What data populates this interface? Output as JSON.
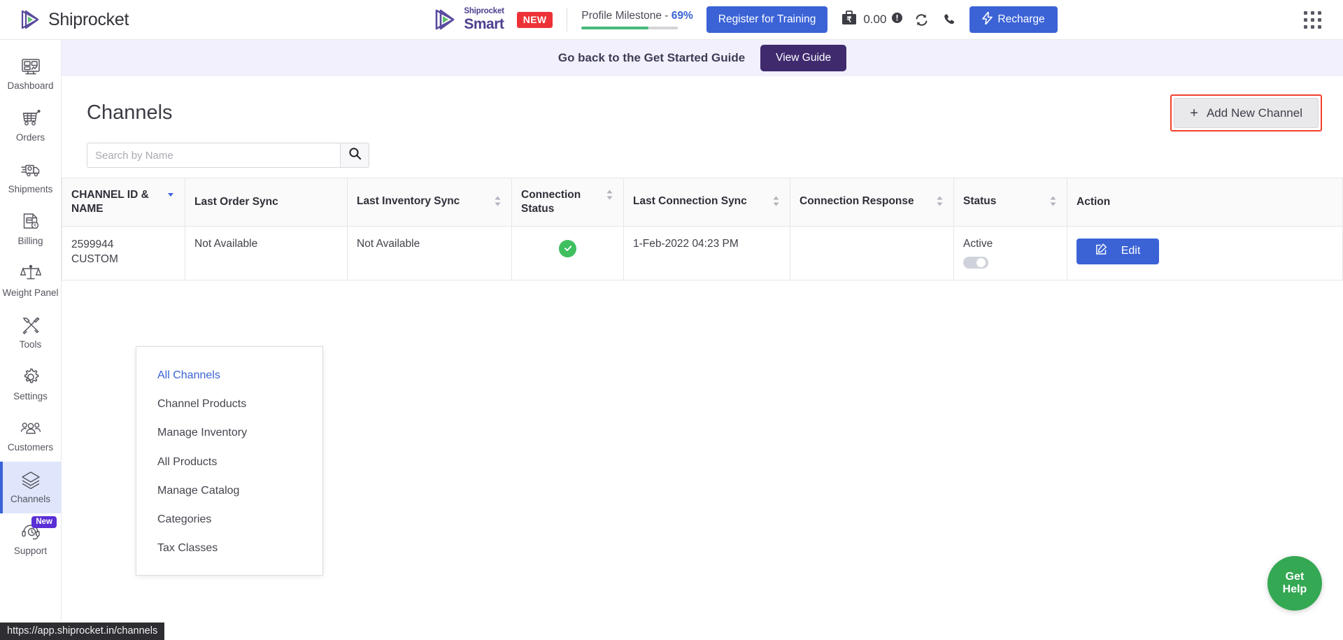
{
  "brand": {
    "name": "Shiprocket",
    "logo_icon": "shiprocket-play-logo"
  },
  "header": {
    "smart": {
      "line1": "Shiprocket",
      "line2": "Smart",
      "badge": "NEW",
      "logo_icon": "shiprocket-smart-logo"
    },
    "milestone": {
      "label_prefix": "Profile Milestone - ",
      "percent": "69%",
      "progress": 69,
      "fill_color": "#45b97c"
    },
    "register_button": "Register for Training",
    "wallet": {
      "amount": "0.00",
      "wallet_icon": "rupee-wallet-icon",
      "info_icon": "info-circle-icon"
    },
    "refresh_icon": "refresh-icon",
    "call_icon": "phone-icon",
    "recharge_button": "Recharge",
    "recharge_icon": "lightning-bolt-icon",
    "apps_grid_icon": "apps-grid-icon",
    "accent_color": "#3b63d6"
  },
  "sidebar": {
    "items": [
      {
        "label": "Dashboard",
        "icon": "dashboard-icon",
        "active": false,
        "badge": null
      },
      {
        "label": "Orders",
        "icon": "orders-cart-icon",
        "active": false,
        "badge": null
      },
      {
        "label": "Shipments",
        "icon": "shipments-truck-icon",
        "active": false,
        "badge": null
      },
      {
        "label": "Billing",
        "icon": "billing-invoice-icon",
        "active": false,
        "badge": null
      },
      {
        "label": "Weight Panel",
        "icon": "weight-scale-icon",
        "active": false,
        "badge": null
      },
      {
        "label": "Tools",
        "icon": "tools-icon",
        "active": false,
        "badge": null
      },
      {
        "label": "Settings",
        "icon": "gear-icon",
        "active": false,
        "badge": null
      },
      {
        "label": "Customers",
        "icon": "customers-group-icon",
        "active": false,
        "badge": null
      },
      {
        "label": "Channels",
        "icon": "channels-layers-icon",
        "active": true,
        "badge": null
      },
      {
        "label": "Support",
        "icon": "support-headset-icon",
        "active": false,
        "badge": "New"
      }
    ]
  },
  "guide_banner": {
    "text": "Go back to the Get Started Guide",
    "button": "View Guide"
  },
  "page": {
    "title": "Channels",
    "add_channel_button": "Add New Channel",
    "add_channel_plus": "+",
    "highlight_color": "#f1402f"
  },
  "search": {
    "placeholder": "Search by Name",
    "value": "",
    "search_icon": "search-icon"
  },
  "table": {
    "columns": [
      {
        "label": "CHANNEL ID & NAME",
        "sort": "desc"
      },
      {
        "label": "Last Order Sync",
        "sort": "none"
      },
      {
        "label": "Last Inventory Sync",
        "sort": "sortable"
      },
      {
        "label": "Connection Status",
        "sort": "sortable"
      },
      {
        "label": "Last Connection Sync",
        "sort": "sortable"
      },
      {
        "label": "Connection Response",
        "sort": "sortable"
      },
      {
        "label": "Status",
        "sort": "sortable"
      },
      {
        "label": "Action",
        "sort": "none"
      }
    ],
    "rows": [
      {
        "channel_id": "2599944",
        "channel_name": "CUSTOM",
        "last_order_sync": "Not Available",
        "last_inventory_sync": "Not Available",
        "connection_status": "connected",
        "connection_status_icon": "check-circle-icon",
        "last_connection_sync": "1-Feb-2022 04:23 PM",
        "connection_response": "",
        "status": "Active",
        "status_toggle": true,
        "action_label": "Edit",
        "action_icon": "edit-pencil-icon"
      }
    ]
  },
  "dropdown": {
    "items": [
      {
        "label": "All Channels",
        "current": true
      },
      {
        "label": "Channel Products",
        "current": false
      },
      {
        "label": "Manage Inventory",
        "current": false
      },
      {
        "label": "All Products",
        "current": false
      },
      {
        "label": "Manage Catalog",
        "current": false
      },
      {
        "label": "Categories",
        "current": false
      },
      {
        "label": "Tax Classes",
        "current": false
      }
    ]
  },
  "get_help": {
    "line1": "Get",
    "line2": "Help",
    "color": "#34a853"
  },
  "status_bar": {
    "url": "https://app.shiprocket.in/channels"
  }
}
